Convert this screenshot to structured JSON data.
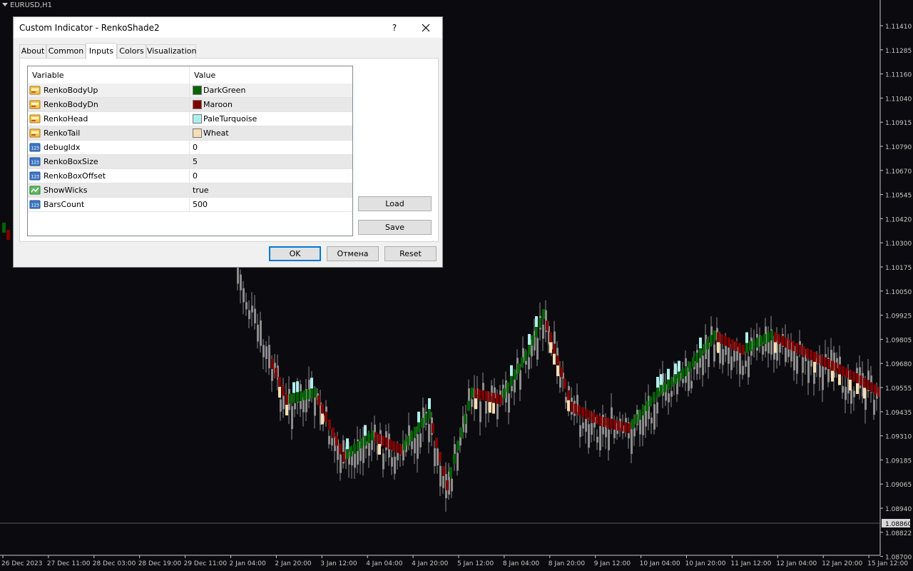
{
  "chart": {
    "symbol_label": "EURUSD,H1",
    "price_ticks": [
      "1.11410",
      "1.11285",
      "1.11160",
      "1.11040",
      "1.10915",
      "1.10790",
      "1.10670",
      "1.10545",
      "1.10420",
      "1.10300",
      "1.10175",
      "1.10050",
      "1.09925",
      "1.09805",
      "1.09680",
      "1.09555",
      "1.09435",
      "1.09310",
      "1.09185",
      "1.09065",
      "1.08940",
      "1.08822",
      "1.08700"
    ],
    "current_price": "1.08860",
    "time_ticks": [
      "26 Dec 2023",
      "27 Dec 11:00",
      "28 Dec 03:00",
      "28 Dec 19:00",
      "29 Dec 11:00",
      "2 Jan 04:00",
      "2 Jan 20:00",
      "3 Jan 12:00",
      "4 Jan 04:00",
      "4 Jan 20:00",
      "5 Jan 12:00",
      "8 Jan 04:00",
      "8 Jan 20:00",
      "9 Jan 12:00",
      "10 Jan 04:00",
      "10 Jan 20:00",
      "11 Jan 12:00",
      "12 Jan 04:00",
      "12 Jan 20:00",
      "15 Jan 12:00"
    ],
    "colors": {
      "background": "#0b0b0f",
      "candle": "#8c8c8c",
      "body_up": "#006400",
      "body_dn": "#800000",
      "head": "#afeeee",
      "tail": "#f5deb3",
      "axis_text": "#c8c8c8"
    }
  },
  "dialog": {
    "title": "Custom Indicator - RenkoShade2",
    "help_label": "?",
    "close_icon": "close-icon",
    "tabs": [
      {
        "label": "About",
        "active": false
      },
      {
        "label": "Common",
        "active": false
      },
      {
        "label": "Inputs",
        "active": true
      },
      {
        "label": "Colors",
        "active": false
      },
      {
        "label": "Visualization",
        "active": false
      }
    ],
    "grid": {
      "col_variable": "Variable",
      "col_value": "Value",
      "rows": [
        {
          "icon": "color-param-icon",
          "name": "RenkoBodyUp",
          "value": "DarkGreen",
          "swatch": "#006400"
        },
        {
          "icon": "color-param-icon",
          "name": "RenkoBodyDn",
          "value": "Maroon",
          "swatch": "#800000"
        },
        {
          "icon": "color-param-icon",
          "name": "RenkoHead",
          "value": "PaleTurquoise",
          "swatch": "#afeeee"
        },
        {
          "icon": "color-param-icon",
          "name": "RenkoTail",
          "value": "Wheat",
          "swatch": "#f5deb3"
        },
        {
          "icon": "integer-param-icon",
          "name": "debugIdx",
          "value": "0"
        },
        {
          "icon": "integer-param-icon",
          "name": "RenkoBoxSize",
          "value": "5"
        },
        {
          "icon": "integer-param-icon",
          "name": "RenkoBoxOffset",
          "value": "0"
        },
        {
          "icon": "bool-param-icon",
          "name": "ShowWicks",
          "value": "true"
        },
        {
          "icon": "integer-param-icon",
          "name": "BarsCount",
          "value": "500"
        }
      ]
    },
    "buttons": {
      "load": "Load",
      "save": "Save",
      "ok": "OK",
      "cancel": "Отмена",
      "reset": "Reset"
    }
  }
}
